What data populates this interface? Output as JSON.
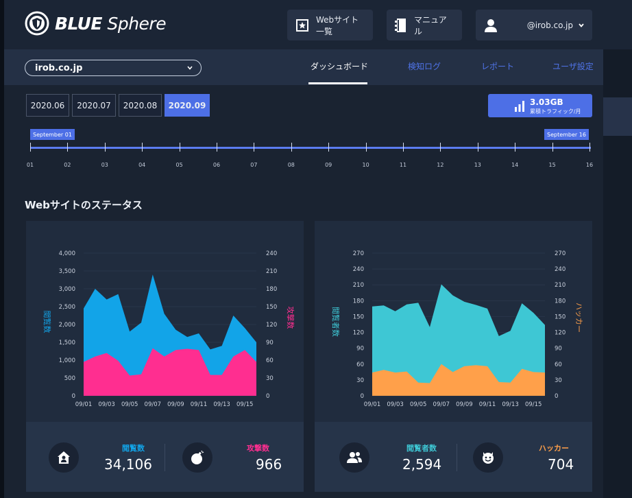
{
  "brand": {
    "bold": "BLUE",
    "light": "Sphere"
  },
  "header": {
    "sites_button": "Webサイト一覧",
    "manual_button": "マニュアル",
    "account_email": "@irob.co.jp"
  },
  "domain_select": {
    "value": "irob.co.jp"
  },
  "tabs": [
    {
      "label": "ダッシュボード",
      "active": true
    },
    {
      "label": "検知ログ",
      "active": false
    },
    {
      "label": "レポート",
      "active": false
    },
    {
      "label": "ユーザ設定",
      "active": false
    }
  ],
  "months": [
    "2020.06",
    "2020.07",
    "2020.08",
    "2020.09"
  ],
  "active_month": "2020.09",
  "traffic": {
    "value": "3.03GB",
    "label": "累積トラフィック/月"
  },
  "timeline": {
    "start_label": "September 01",
    "end_label": "September 16",
    "days": [
      "01",
      "02",
      "03",
      "04",
      "05",
      "06",
      "07",
      "08",
      "09",
      "10",
      "11",
      "12",
      "13",
      "14",
      "15",
      "16"
    ]
  },
  "section_title": "Webサイトのステータス",
  "colors": {
    "accent": "#4d6fe6",
    "views": "#12a4e8",
    "attacks": "#ff2e90",
    "visitors": "#3ec7d4",
    "hackers": "#ffa04a"
  },
  "chart_data": [
    {
      "type": "area",
      "x": [
        "09/01",
        "09/02",
        "09/03",
        "09/04",
        "09/05",
        "09/06",
        "09/07",
        "09/08",
        "09/09",
        "09/10",
        "09/11",
        "09/12",
        "09/13",
        "09/14",
        "09/15",
        "09/16"
      ],
      "x_tick_labels": [
        "09/01",
        "09/03",
        "09/05",
        "09/07",
        "09/09",
        "09/11",
        "09/13",
        "09/15"
      ],
      "series": [
        {
          "name": "閲覧数",
          "axis": "left",
          "values": [
            2450,
            3000,
            2700,
            2850,
            1800,
            2050,
            3400,
            2300,
            1850,
            1650,
            1750,
            1300,
            1400,
            2250,
            1900,
            1500
          ]
        },
        {
          "name": "攻撃数",
          "axis": "right",
          "values": [
            57,
            66,
            72,
            59,
            34,
            36,
            80,
            66,
            77,
            79,
            77,
            35,
            35,
            66,
            77,
            57
          ]
        }
      ],
      "ylabel": "閲覧数",
      "y2label": "攻撃数",
      "ylim": [
        0,
        4000
      ],
      "yticks": [
        0,
        500,
        1000,
        1500,
        2000,
        2500,
        3000,
        3500,
        4000
      ],
      "y2lim": [
        0,
        240
      ],
      "y2ticks": [
        0,
        30,
        60,
        90,
        120,
        150,
        180,
        210,
        240
      ]
    },
    {
      "type": "area",
      "x": [
        "09/01",
        "09/02",
        "09/03",
        "09/04",
        "09/05",
        "09/06",
        "09/07",
        "09/08",
        "09/09",
        "09/10",
        "09/11",
        "09/12",
        "09/13",
        "09/14",
        "09/15",
        "09/16"
      ],
      "x_tick_labels": [
        "09/01",
        "09/03",
        "09/05",
        "09/07",
        "09/09",
        "09/11",
        "09/13",
        "09/15"
      ],
      "series": [
        {
          "name": "閲覧者数",
          "axis": "left",
          "values": [
            169,
            171,
            160,
            173,
            176,
            130,
            211,
            190,
            178,
            172,
            165,
            113,
            123,
            175,
            157,
            134
          ]
        },
        {
          "name": "ハッカー",
          "axis": "right",
          "values": [
            44,
            49,
            44,
            46,
            25,
            24,
            60,
            45,
            56,
            58,
            56,
            26,
            25,
            51,
            45,
            44
          ]
        }
      ],
      "ylabel": "閲覧者数",
      "y2label": "ハッカー",
      "ylim": [
        0,
        270
      ],
      "yticks": [
        0,
        30,
        60,
        90,
        120,
        150,
        180,
        210,
        240,
        270
      ],
      "y2lim": [
        0,
        270
      ],
      "y2ticks": [
        0,
        30,
        60,
        90,
        120,
        150,
        180,
        210,
        240,
        270
      ]
    }
  ],
  "stats": {
    "views": {
      "label": "閲覧数",
      "value": "34,106"
    },
    "attacks": {
      "label": "攻撃数",
      "value": "966"
    },
    "visitors": {
      "label": "閲覧者数",
      "value": "2,594"
    },
    "hackers": {
      "label": "ハッカー",
      "value": "704"
    }
  }
}
